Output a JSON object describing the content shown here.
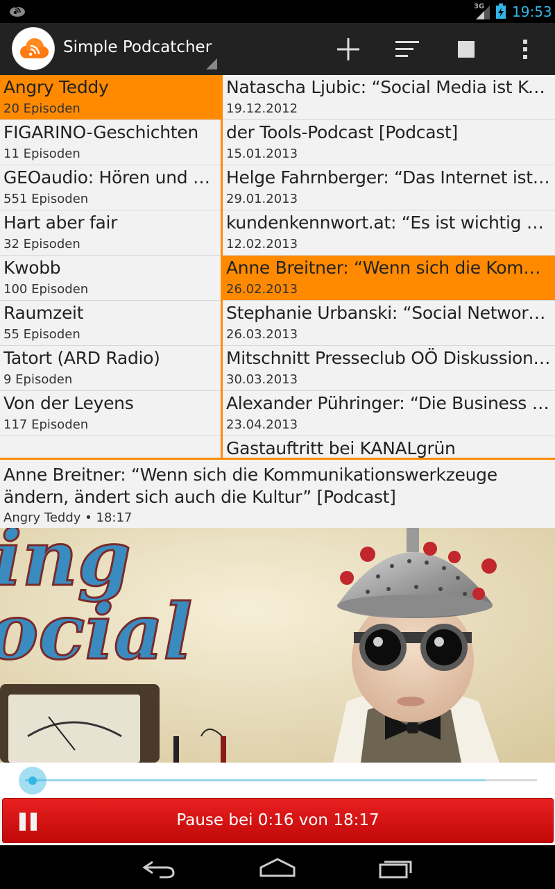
{
  "status_bar": {
    "network": "3G",
    "time": "19:53"
  },
  "action_bar": {
    "title": "Simple Podcatcher",
    "icons": [
      "add-icon",
      "sort-icon",
      "select-all-icon",
      "overflow-menu-icon"
    ]
  },
  "podcasts": [
    {
      "title": "Angry Teddy",
      "count": "20 Episoden",
      "selected": true
    },
    {
      "title": "FIGARINO-Geschichten",
      "count": "11 Episoden",
      "selected": false
    },
    {
      "title": "GEOaudio: Hören und Reisen",
      "count": "551 Episoden",
      "selected": false
    },
    {
      "title": "Hart aber fair",
      "count": "32 Episoden",
      "selected": false
    },
    {
      "title": "Kwobb",
      "count": "100 Episoden",
      "selected": false
    },
    {
      "title": "Raumzeit",
      "count": "55 Episoden",
      "selected": false
    },
    {
      "title": "Tatort (ARD Radio)",
      "count": "9 Episoden",
      "selected": false
    },
    {
      "title": "Von der Leyens",
      "count": "117 Episoden",
      "selected": false
    }
  ],
  "episodes": [
    {
      "title": "Natascha Ljubic: “Social Media ist Kommunikation”",
      "date": "19.12.2012",
      "selected": false
    },
    {
      "title": "der Tools-Podcast [Podcast]",
      "date": "15.01.2013",
      "selected": false
    },
    {
      "title": "Helge Fahrnberger: “Das Internet ist ein Werkzeug”",
      "date": "29.01.2013",
      "selected": false
    },
    {
      "title": "kundenkennwort.at: “Es ist wichtig als Unternehmen”",
      "date": "12.02.2013",
      "selected": false
    },
    {
      "title": "Anne Breitner: “Wenn sich die Kommunikationswerkzeuge ändern”",
      "date": "26.02.2013",
      "selected": true
    },
    {
      "title": "Stephanie Urbanski: “Social Networks und Unternehmen”",
      "date": "26.03.2013",
      "selected": false
    },
    {
      "title": "Mitschnitt Presseclub OÖ Diskussion Social Media",
      "date": "30.03.2013",
      "selected": false
    },
    {
      "title": "Alexander Pühringer: “Die Business App”",
      "date": "23.04.2013",
      "selected": false
    },
    {
      "title": "Gastauftritt bei KANALgrün",
      "date": "",
      "selected": false
    }
  ],
  "now_playing": {
    "title": "Anne Breitner: “Wenn sich die Kommunikationswerkzeuge ändern, ändert sich auch die Kultur” [Podcast]",
    "meta": "Angry Teddy • 18:17",
    "artwork_text": [
      "ing",
      "ocial"
    ]
  },
  "player": {
    "progress": 0.0146,
    "buffered": 0.9,
    "button_label": "Pause bei 0:16 von 18:17"
  },
  "colors": {
    "accent": "#ff8a00",
    "holo_blue": "#33b5e5",
    "button_red": "#d81010",
    "artwork_text": "#3a8cc0"
  },
  "nav_bar": {
    "icons": [
      "back-icon",
      "home-icon",
      "recent-apps-icon"
    ]
  }
}
